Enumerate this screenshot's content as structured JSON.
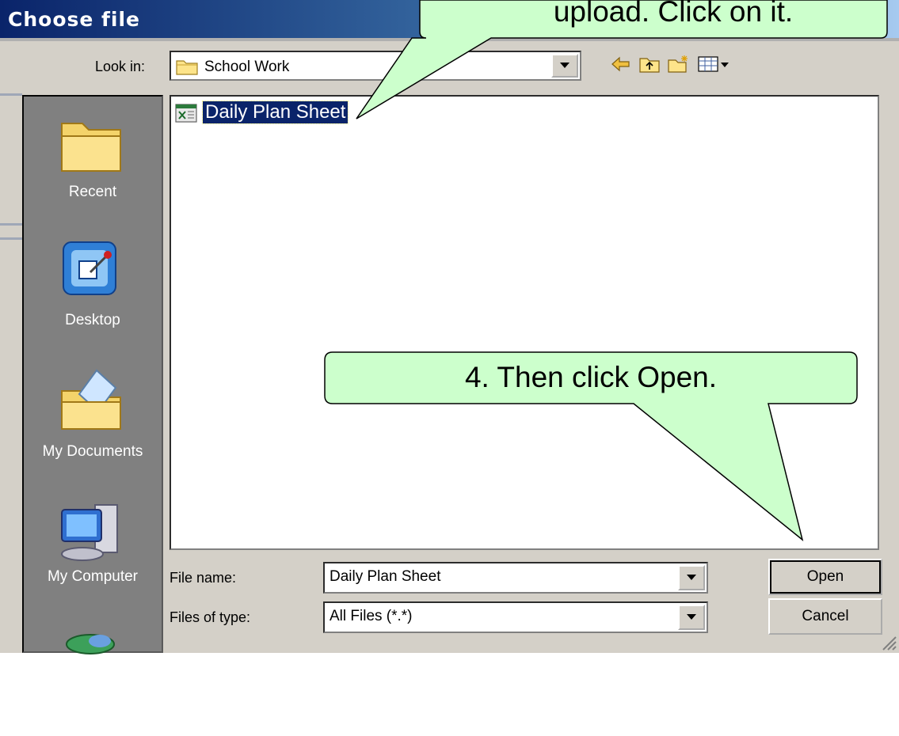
{
  "dialog": {
    "title": "Choose file",
    "look_in_label": "Look in:",
    "look_in_value": "School Work"
  },
  "places": [
    {
      "label": "Recent",
      "icon": "recent-folder-icon"
    },
    {
      "label": "Desktop",
      "icon": "desktop-icon"
    },
    {
      "label": "My Documents",
      "icon": "my-documents-icon"
    },
    {
      "label": "My Computer",
      "icon": "my-computer-icon"
    },
    {
      "label": "",
      "icon": "my-network-icon"
    }
  ],
  "files": [
    {
      "name": "Daily Plan Sheet",
      "icon": "excel-file-icon",
      "selected": true
    }
  ],
  "form": {
    "file_name_label": "File name:",
    "file_name_value": "Daily Plan Sheet",
    "file_type_label": "Files of type:",
    "file_type_value": "All Files (*.*)"
  },
  "buttons": {
    "open": "Open",
    "cancel": "Cancel"
  },
  "callouts": {
    "top": "upload. Click on it.",
    "bottom": "4. Then click Open."
  },
  "colors": {
    "title_bar_start": "#0a246a",
    "dialog_face": "#d4d0c8",
    "places_bar": "#808080",
    "selection": "#0a246a",
    "callout_fill": "#ccffcc"
  }
}
